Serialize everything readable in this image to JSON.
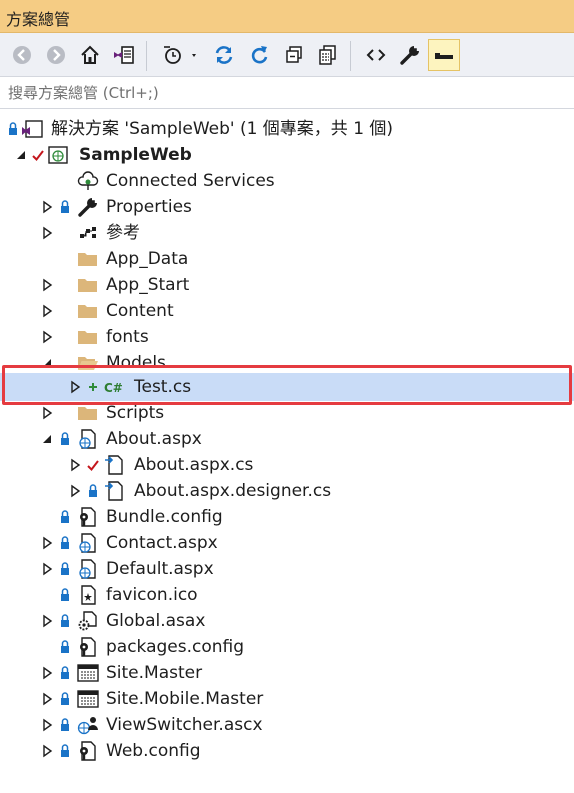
{
  "panel": {
    "title": "方案總管"
  },
  "toolbar": {
    "buttons": [
      {
        "icon": "back-icon"
      },
      {
        "icon": "forward-icon"
      },
      {
        "icon": "home-icon"
      },
      {
        "icon": "switch-views-icon"
      },
      {
        "icon": "pending-changes-filter-icon"
      },
      {
        "icon": "sync-icon"
      },
      {
        "icon": "refresh-icon"
      },
      {
        "icon": "collapse-all-icon"
      },
      {
        "icon": "show-all-files-icon"
      },
      {
        "icon": "view-code-icon"
      },
      {
        "icon": "properties-icon"
      },
      {
        "icon": "preview-selected-items-icon"
      }
    ]
  },
  "search": {
    "placeholder": "搜尋方案總管 (Ctrl+;)"
  },
  "tree": {
    "solution": "解決方案 'SampleWeb' (1 個專案，共 1 個)",
    "items": [
      {
        "label": "SampleWeb",
        "icon": "web-project-icon"
      },
      {
        "label": "Connected Services",
        "icon": "connected-services-icon"
      },
      {
        "label": "Properties",
        "icon": "wrench-icon"
      },
      {
        "label": "參考",
        "icon": "references-icon"
      },
      {
        "label": "App_Data",
        "icon": "folder-icon"
      },
      {
        "label": "App_Start",
        "icon": "folder-icon"
      },
      {
        "label": "Content",
        "icon": "folder-icon"
      },
      {
        "label": "fonts",
        "icon": "folder-icon"
      },
      {
        "label": "Models",
        "icon": "folder-open-icon"
      },
      {
        "label": "Test.cs",
        "icon": "csharp-file-icon"
      },
      {
        "label": "Scripts",
        "icon": "folder-icon"
      },
      {
        "label": "About.aspx",
        "icon": "web-form-icon"
      },
      {
        "label": "About.aspx.cs",
        "icon": "code-file-icon"
      },
      {
        "label": "About.aspx.designer.cs",
        "icon": "code-file-icon"
      },
      {
        "label": "Bundle.config",
        "icon": "config-file-icon"
      },
      {
        "label": "Contact.aspx",
        "icon": "web-form-icon"
      },
      {
        "label": "Default.aspx",
        "icon": "web-form-icon"
      },
      {
        "label": "favicon.ico",
        "icon": "icon-file-icon"
      },
      {
        "label": "Global.asax",
        "icon": "global-asax-icon"
      },
      {
        "label": "packages.config",
        "icon": "config-file-icon"
      },
      {
        "label": "Site.Master",
        "icon": "master-page-icon"
      },
      {
        "label": "Site.Mobile.Master",
        "icon": "master-page-icon"
      },
      {
        "label": "ViewSwitcher.ascx",
        "icon": "user-control-icon"
      },
      {
        "label": "Web.config",
        "icon": "config-file-icon"
      }
    ]
  },
  "colors": {
    "title_bar": "#f5cc84",
    "selection": "#c9dcf7",
    "highlight_border": "#e53b40",
    "lock_blue": "#1a73c7",
    "check_red": "#c4161c",
    "add_green": "#2e8b3a",
    "folder": "#dcb67a"
  }
}
